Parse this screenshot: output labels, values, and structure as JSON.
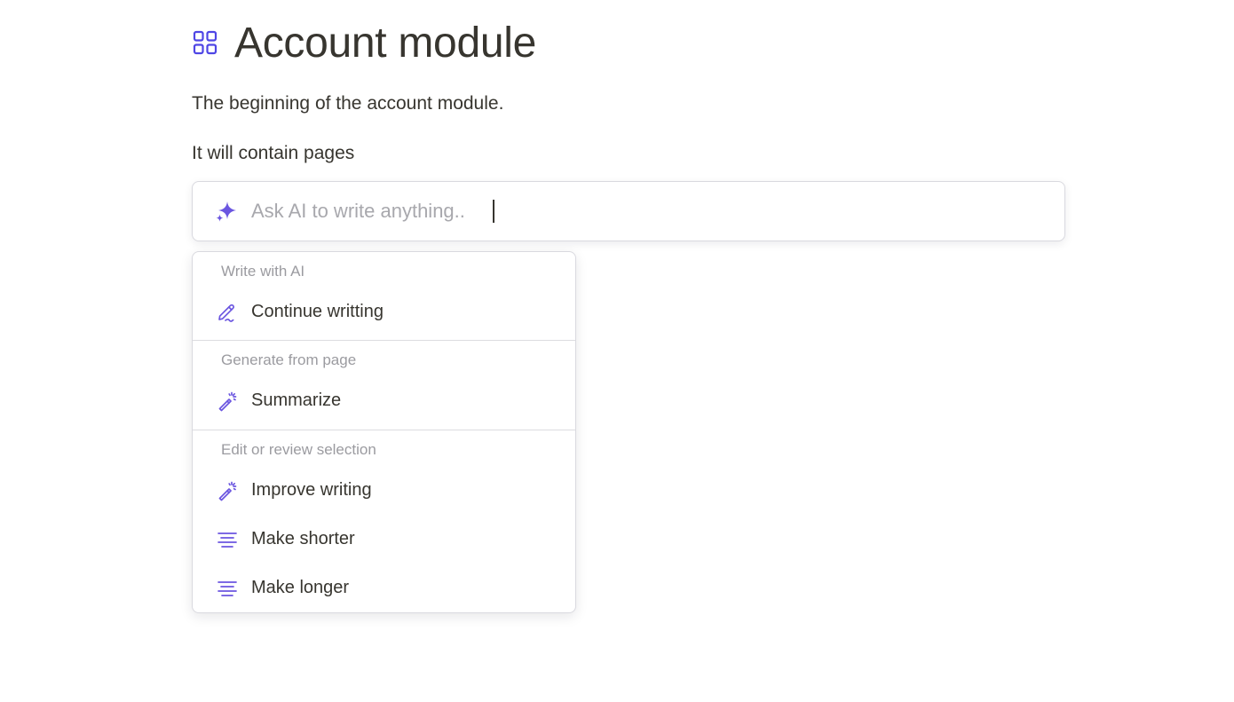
{
  "page": {
    "title": "Account module",
    "title_icon": "grid-icon",
    "paragraphs": [
      "The beginning of the account module.",
      "It will contain pages"
    ]
  },
  "ai_prompt": {
    "placeholder": "Ask AI to write anything..",
    "value": "",
    "icon": "sparkle-icon"
  },
  "ai_menu": {
    "sections": [
      {
        "header": "Write with AI",
        "items": [
          {
            "label": "Continue writting",
            "icon": "pen-icon"
          }
        ]
      },
      {
        "header": "Generate from page",
        "items": [
          {
            "label": "Summarize",
            "icon": "magic-wand-icon"
          }
        ]
      },
      {
        "header": "Edit or review selection",
        "items": [
          {
            "label": "Improve writing",
            "icon": "magic-wand-icon"
          },
          {
            "label": "Make shorter",
            "icon": "text-align-icon"
          },
          {
            "label": "Make longer",
            "icon": "text-align-icon"
          }
        ]
      }
    ]
  },
  "colors": {
    "accent": "#6b56e0",
    "text": "#37352f",
    "muted": "#9b9ba0",
    "border": "#d9d9df"
  }
}
